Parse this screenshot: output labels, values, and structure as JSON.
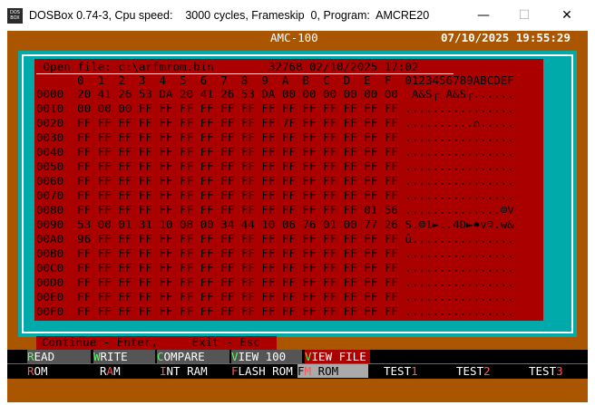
{
  "window": {
    "icon_label": "DOS BOX",
    "title": "DOSBox 0.74-3, Cpu speed:    3000 cycles, Frameskip  0, Program:  AMCRE20",
    "minimize": "—",
    "maximize": "☐",
    "close": "✕"
  },
  "header": {
    "title": "AMC-100",
    "datetime": "07/10/2025 19:55:29"
  },
  "file": {
    "open_line": " Open file: c:\\arfmrom.bin        32768 02/10/2025 17:02 "
  },
  "hex": {
    "header": "      0  1  2  3  4  5  6  7  8  9  A  B  C  D  E  F  0123456789ABCDEF",
    "rows": [
      {
        "offset": "0000",
        "bytes": "20 41 26 53 DA 20 41 26 53 DA 00 00 00 00 00 00",
        "ascii": " A&S┌ A&S┌......"
      },
      {
        "offset": "0010",
        "bytes": "00 00 00 FF FF FF FF FF FF FF FF FF FF FF FF FF",
        "ascii": "................"
      },
      {
        "offset": "0020",
        "bytes": "FF FF FF FF FF FF FF FF FF FF 7F FF FF FF FF FF",
        "ascii": "..........⌂....."
      },
      {
        "offset": "0030",
        "bytes": "FF FF FF FF FF FF FF FF FF FF FF FF FF FF FF FF",
        "ascii": "................"
      },
      {
        "offset": "0040",
        "bytes": "FF FF FF FF FF FF FF FF FF FF FF FF FF FF FF FF",
        "ascii": "................"
      },
      {
        "offset": "0050",
        "bytes": "FF FF FF FF FF FF FF FF FF FF FF FF FF FF FF FF",
        "ascii": "................"
      },
      {
        "offset": "0060",
        "bytes": "FF FF FF FF FF FF FF FF FF FF FF FF FF FF FF FF",
        "ascii": "................"
      },
      {
        "offset": "0070",
        "bytes": "FF FF FF FF FF FF FF FF FF FF FF FF FF FF FF FF",
        "ascii": "................"
      },
      {
        "offset": "0080",
        "bytes": "FF FF FF FF FF FF FF FF FF FF FF FF FF FF 01 56",
        "ascii": "..............☺V"
      },
      {
        "offset": "0090",
        "bytes": "53 00 01 31 10 08 00 34 44 10 06 76 01 00 77 26",
        "ascii": "S.☺1►..4D►♠v☺.w&"
      },
      {
        "offset": "00A0",
        "bytes": "96 FF FF FF FF FF FF FF FF FF FF FF FF FF FF FF",
        "ascii": "û..............."
      },
      {
        "offset": "00B0",
        "bytes": "FF FF FF FF FF FF FF FF FF FF FF FF FF FF FF FF",
        "ascii": "................"
      },
      {
        "offset": "00C0",
        "bytes": "FF FF FF FF FF FF FF FF FF FF FF FF FF FF FF FF",
        "ascii": "................"
      },
      {
        "offset": "00D0",
        "bytes": "FF FF FF FF FF FF FF FF FF FF FF FF FF FF FF FF",
        "ascii": "................"
      },
      {
        "offset": "00E0",
        "bytes": "FF FF FF FF FF FF FF FF FF FF FF FF FF FF FF FF",
        "ascii": "................"
      },
      {
        "offset": "00F0",
        "bytes": "FF FF FF FF FF FF FF FF FF FF FF FF FF FF FF FF",
        "ascii": "................"
      }
    ]
  },
  "status": {
    "text": "Continue - Enter,     Exit - Esc"
  },
  "menu_top": [
    {
      "hot": "R",
      "rest": "EAD"
    },
    {
      "hot": "W",
      "rest": "RITE"
    },
    {
      "hot": "C",
      "rest": "OMPARE"
    },
    {
      "hot": "V",
      "rest": "IEW 100"
    },
    {
      "hot": "V",
      "rest": "IEW FILE"
    }
  ],
  "menu_bottom": [
    {
      "hot": "R",
      "rest": "OM"
    },
    {
      "pre": "R",
      "hot": "A",
      "rest": "M"
    },
    {
      "hot": "I",
      "rest": "NT RAM"
    },
    {
      "hot": "F",
      "rest": "LASH ROM"
    },
    {
      "pre": "F",
      "hot": "M",
      "rest": " ROM"
    },
    {
      "pre": "TEST",
      "hot": "1",
      "rest": ""
    },
    {
      "pre": "TEST",
      "hot": "2",
      "rest": ""
    },
    {
      "pre": "TEST",
      "hot": "3",
      "rest": ""
    }
  ],
  "colors": {
    "dos_bg": "#aa5500",
    "panel": "#aa0000",
    "frame": "#00aaaa",
    "hotkey": "#55ff55"
  }
}
